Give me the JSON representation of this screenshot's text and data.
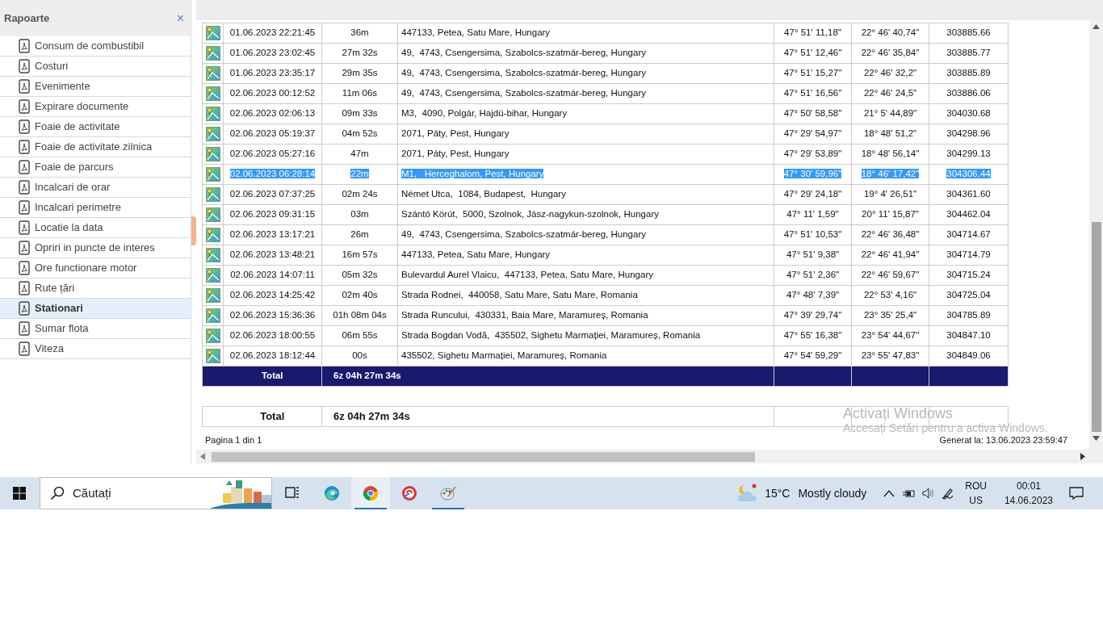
{
  "sidebar": {
    "title": "Rapoarte",
    "close": "×",
    "items": [
      {
        "label": "Consum de combustibil",
        "selected": false
      },
      {
        "label": "Costuri",
        "selected": false
      },
      {
        "label": "Evenimente",
        "selected": false
      },
      {
        "label": "Expirare documente",
        "selected": false
      },
      {
        "label": "Foaie de activitate",
        "selected": false
      },
      {
        "label": "Foaie de activitate zilnica",
        "selected": false
      },
      {
        "label": "Foaie de parcurs",
        "selected": false
      },
      {
        "label": "Incalcari de orar",
        "selected": false
      },
      {
        "label": "Incalcari perimetre",
        "selected": false
      },
      {
        "label": "Locatie la data",
        "selected": false
      },
      {
        "label": "Opriri in puncte de interes",
        "selected": false
      },
      {
        "label": "Ore functionare motor",
        "selected": false
      },
      {
        "label": "Rute țări",
        "selected": false
      },
      {
        "label": "Stationari",
        "selected": true
      },
      {
        "label": "Sumar flota",
        "selected": false
      },
      {
        "label": "Viteza",
        "selected": false
      }
    ]
  },
  "table": {
    "rows": [
      {
        "date": "01.06.2023 22:21:45",
        "duration": "36m",
        "address": "447133, Petea, Satu Mare, Hungary",
        "lat": "47° 51' 11,18\"",
        "lon": "22° 46' 40,74\"",
        "km": "303885.66",
        "selected": false
      },
      {
        "date": "01.06.2023 23:02:45",
        "duration": "27m 32s",
        "address": "49,  4743, Csengersima, Szabolcs-szatmár-bereg, Hungary",
        "lat": "47° 51' 12,46\"",
        "lon": "22° 46' 35,84\"",
        "km": "303885.77",
        "selected": false
      },
      {
        "date": "01.06.2023 23:35:17",
        "duration": "29m 35s",
        "address": "49,  4743, Csengersima, Szabolcs-szatmár-bereg, Hungary",
        "lat": "47° 51' 15,27\"",
        "lon": "22° 46' 32,2\"",
        "km": "303885.89",
        "selected": false
      },
      {
        "date": "02.06.2023 00:12:52",
        "duration": "11m 06s",
        "address": "49,  4743, Csengersima, Szabolcs-szatmár-bereg, Hungary",
        "lat": "47° 51' 16,56\"",
        "lon": "22° 46' 24,5\"",
        "km": "303886.06",
        "selected": false
      },
      {
        "date": "02.06.2023 02:06:13",
        "duration": "09m 33s",
        "address": "M3,  4090, Polgár, Hajdú-bihar, Hungary",
        "lat": "47° 50' 58,58\"",
        "lon": "21° 5' 44,89\"",
        "km": "304030.68",
        "selected": false
      },
      {
        "date": "02.06.2023 05:19:37",
        "duration": "04m 52s",
        "address": "2071, Páty, Pest, Hungary",
        "lat": "47° 29' 54,97\"",
        "lon": "18° 48' 51,2\"",
        "km": "304298.96",
        "selected": false
      },
      {
        "date": "02.06.2023 05:27:16",
        "duration": "47m",
        "address": "2071, Páty, Pest, Hungary",
        "lat": "47° 29' 53,89\"",
        "lon": "18° 48' 56,14\"",
        "km": "304299.13",
        "selected": false
      },
      {
        "date": "02.06.2023 06:28:14",
        "duration": "22m",
        "address": "M1,   Herceghalom, Pest, Hungary",
        "lat": "47° 30' 59,96\"",
        "lon": "18° 46' 17,42\"",
        "km": "304306.44",
        "selected": true
      },
      {
        "date": "02.06.2023 07:37:25",
        "duration": "02m 24s",
        "address": "Német Utca,  1084, Budapest,  Hungary",
        "lat": "47° 29' 24,18\"",
        "lon": "19° 4' 26,51\"",
        "km": "304361.60",
        "selected": false
      },
      {
        "date": "02.06.2023 09:31:15",
        "duration": "03m",
        "address": "Szántó Körút,  5000, Szolnok, Jász-nagykun-szolnok, Hungary",
        "lat": "47° 11' 1,59\"",
        "lon": "20° 11' 15,87\"",
        "km": "304462.04",
        "selected": false
      },
      {
        "date": "02.06.2023 13:17:21",
        "duration": "26m",
        "address": "49,  4743, Csengersima, Szabolcs-szatmár-bereg, Hungary",
        "lat": "47° 51' 10,53\"",
        "lon": "22° 46' 36,48\"",
        "km": "304714.67",
        "selected": false
      },
      {
        "date": "02.06.2023 13:48:21",
        "duration": "16m 57s",
        "address": "447133, Petea, Satu Mare, Hungary",
        "lat": "47° 51' 9,38\"",
        "lon": "22° 46' 41,94\"",
        "km": "304714.79",
        "selected": false
      },
      {
        "date": "02.06.2023 14:07:11",
        "duration": "05m 32s",
        "address": "Bulevardul Aurel Vlaicu,  447133, Petea, Satu Mare, Hungary",
        "lat": "47° 51' 2,36\"",
        "lon": "22° 46' 59,67\"",
        "km": "304715.24",
        "selected": false
      },
      {
        "date": "02.06.2023 14:25:42",
        "duration": "02m 40s",
        "address": "Strada Rodnei,  440058, Satu Mare, Satu Mare, Romania",
        "lat": "47° 48' 7,39\"",
        "lon": "22° 53' 4,16\"",
        "km": "304725.04",
        "selected": false
      },
      {
        "date": "02.06.2023 15:36:36",
        "duration": "01h 08m 04s",
        "address": "Strada Runcului,  430331, Baia Mare, Maramureș, Romania",
        "lat": "47° 39' 29,74\"",
        "lon": "23° 35' 25,4\"",
        "km": "304785.89",
        "selected": false
      },
      {
        "date": "02.06.2023 18:00:55",
        "duration": "06m 55s",
        "address": "Strada Bogdan Vodă,  435502, Sighetu Marmației, Maramureș, Romania",
        "lat": "47° 55' 16,38\"",
        "lon": "23° 54' 44,67\"",
        "km": "304847.10",
        "selected": false
      },
      {
        "date": "02.06.2023 18:12:44",
        "duration": "00s",
        "address": "435502, Sighetu Marmației, Maramureș, Romania",
        "lat": "47° 54' 59,29\"",
        "lon": "23° 55' 47,83\"",
        "km": "304849.06",
        "selected": false
      }
    ],
    "total": {
      "label": "Total",
      "value": "6z 04h 27m 34s"
    }
  },
  "summary": {
    "label": "Total",
    "value": "6z 04h 27m 34s"
  },
  "footer": {
    "pages": "Pagina 1 din 1",
    "generated": "Generat la: 13.06.2023 23:59:47"
  },
  "activation": {
    "title": "Activați Windows",
    "subtitle": "Accesați Setări pentru a activa Windows."
  },
  "taskbar": {
    "search": {
      "placeholder": "Căutați"
    },
    "apps": [
      {
        "kind": "taskview",
        "selected": false,
        "running": false
      },
      {
        "kind": "edge",
        "selected": false,
        "running": false
      },
      {
        "kind": "chrome",
        "selected": true,
        "running": true
      },
      {
        "kind": "app",
        "selected": false,
        "running": false
      },
      {
        "kind": "paint",
        "selected": false,
        "running": true
      }
    ],
    "weather": {
      "temp": "15°C",
      "text": "Mostly cloudy"
    },
    "language": [
      "ROU",
      "US"
    ],
    "time": "00:01",
    "date": "14.06.2023"
  }
}
